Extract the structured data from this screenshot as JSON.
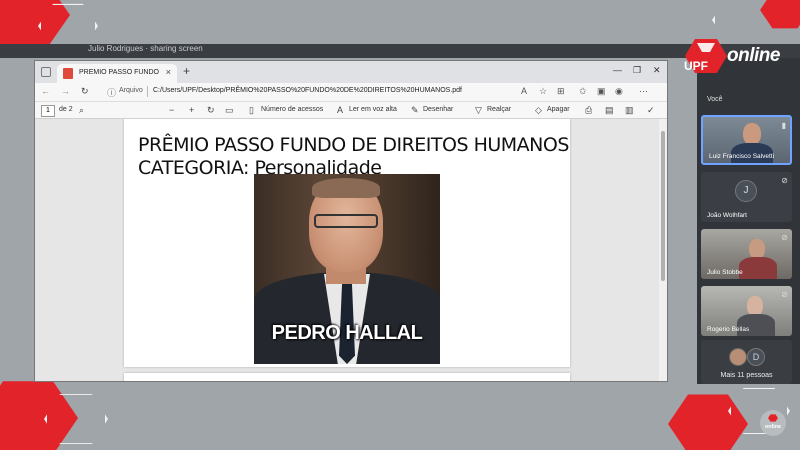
{
  "meeting": {
    "top_text": "Julio Rodrigues · sharing screen"
  },
  "browser": {
    "tab_title": "PRÊMIO PASSO FUNDO DE DI...",
    "tab_close": "×",
    "new_tab": "+",
    "window_controls": [
      "—",
      "❐",
      "✕"
    ],
    "address": {
      "label": "Arquivo",
      "url": "C:/Users/UPF/Desktop/PRÊMIO%20PASSO%20FUNDO%20DE%20DIREITOS%20HUMANOS.pdf"
    },
    "pdf_toolbar": {
      "page_current": "1",
      "page_total": "de 2",
      "read_aloud_access": "Número de acessos",
      "read_aloud": "Ler em voz alta",
      "draw": "Desenhar",
      "highlight": "Realçar",
      "erase": "Apagar"
    }
  },
  "document": {
    "line1": "PRÊMIO PASSO FUNDO DE DIREITOS HUMANOS",
    "line2": "CATEGORIA: Personalidade",
    "photo_caption": "PEDRO HALLAL"
  },
  "sidebar": {
    "logo_upf": "UPF",
    "logo_online": "online",
    "section_label": "Você",
    "participants": [
      {
        "name": "Luiz Francisco Salvetti",
        "initial": ""
      },
      {
        "name": "João Wolhfart",
        "initial": "J"
      },
      {
        "name": "Julio Stobbe",
        "initial": ""
      },
      {
        "name": "Rogerio Bellas",
        "initial": ""
      }
    ],
    "more_initial": "D",
    "more_text": "Mais 11 pessoas"
  },
  "bottom_logo": "online",
  "colors": {
    "accent_red": "#e2232a",
    "panel_dark": "#313438"
  }
}
